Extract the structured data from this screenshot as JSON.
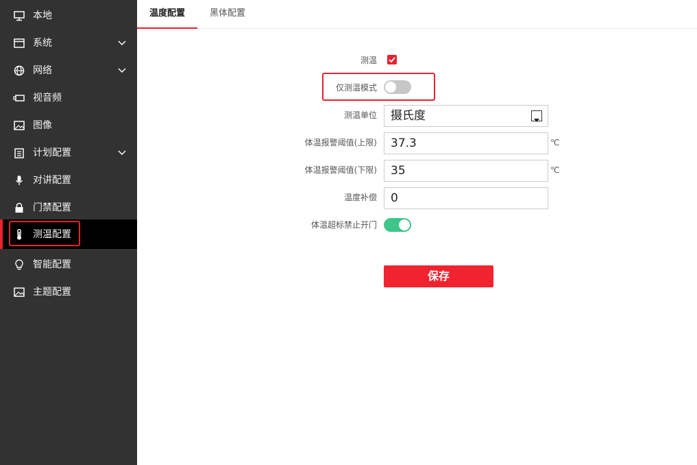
{
  "sidebar": {
    "items": [
      {
        "label": "本地",
        "icon": "monitor-icon"
      },
      {
        "label": "系统",
        "icon": "window-icon",
        "expandable": true
      },
      {
        "label": "网络",
        "icon": "globe-icon",
        "expandable": true
      },
      {
        "label": "视音频",
        "icon": "camera-icon"
      },
      {
        "label": "图像",
        "icon": "image-icon"
      },
      {
        "label": "计划配置",
        "icon": "clipboard-icon",
        "expandable": true
      },
      {
        "label": "对讲配置",
        "icon": "microphone-icon"
      },
      {
        "label": "门禁配置",
        "icon": "lock-icon"
      },
      {
        "label": "测温配置",
        "icon": "thermometer-icon",
        "active": true
      },
      {
        "label": "智能配置",
        "icon": "lightbulb-icon"
      },
      {
        "label": "主题配置",
        "icon": "picture-icon"
      }
    ]
  },
  "tabs": [
    {
      "label": "温度配置",
      "active": true
    },
    {
      "label": "黑体配置",
      "active": false
    }
  ],
  "form": {
    "measure_temp": {
      "label": "测温",
      "checked": true
    },
    "temp_only_mode": {
      "label": "仅测温模式",
      "enabled": false
    },
    "temp_unit": {
      "label": "测温单位",
      "value": "摄氏度"
    },
    "alarm_upper": {
      "label": "体温报警阈值(上限)",
      "value": "37.3",
      "unit": "℃"
    },
    "alarm_lower": {
      "label": "体温报警阈值(下限)",
      "value": "35",
      "unit": "℃"
    },
    "temp_compensation": {
      "label": "温度补偿",
      "value": "0"
    },
    "block_door_on_abnormal": {
      "label": "体温超标禁止开门",
      "enabled": true
    }
  },
  "save_label": "保存",
  "colors": {
    "sidebar_bg": "#323232",
    "active_item_bg": "#000000",
    "accent_red": "#e8222f",
    "toggle_on": "#3fc58a",
    "toggle_off": "#c7c7c7"
  }
}
